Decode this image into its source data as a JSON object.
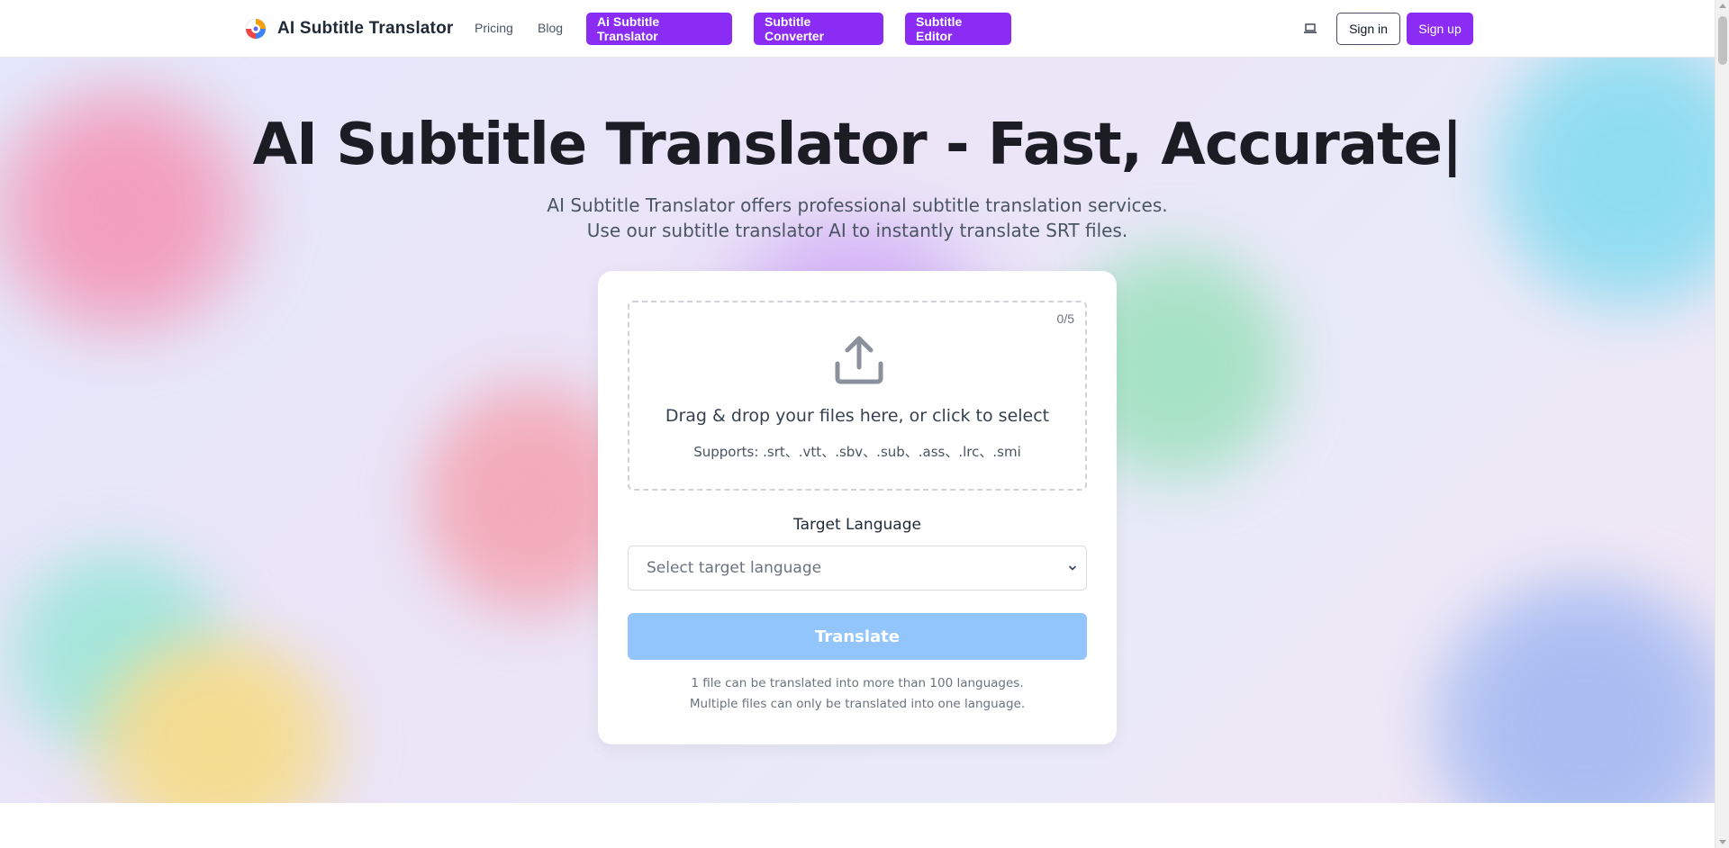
{
  "header": {
    "brand_name": "AI Subtitle Translator",
    "nav_links": [
      {
        "label": "Pricing"
      },
      {
        "label": "Blog"
      }
    ],
    "nav_buttons": [
      {
        "label": "Ai Subtitle Translator"
      },
      {
        "label": "Subtitle Converter"
      },
      {
        "label": "Subtitle Editor"
      }
    ],
    "sign_in_label": "Sign in",
    "sign_up_label": "Sign up",
    "accent_color": "#8b2cf5"
  },
  "hero": {
    "title": "AI Subtitle Translator - Fast, Accurate|",
    "subtitle": "AI Subtitle Translator offers professional subtitle translation services. Use our subtitle translator AI to instantly translate SRT files."
  },
  "uploader": {
    "file_count": "0/5",
    "drop_text": "Drag & drop your files here, or click to select",
    "supports_text": "Supports: .srt、.vtt、.sbv、.sub、.ass、.lrc、.smi",
    "target_language_label": "Target Language",
    "target_language_placeholder": "Select target language",
    "translate_label": "Translate",
    "translate_color": "#93c5fd",
    "note_line1": "1 file can be translated into more than 100 languages.",
    "note_line2": "Multiple files can only be translated into one language."
  },
  "icons": {
    "logo": "brand-logo-icon",
    "laptop": "laptop-icon",
    "upload": "upload-icon",
    "select_chevron": "chevron-down-icon"
  }
}
